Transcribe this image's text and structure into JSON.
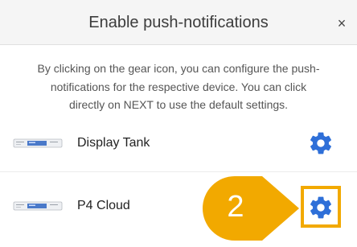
{
  "dialog": {
    "title": "Enable push-notifications",
    "close_label": "×"
  },
  "description": "By clicking on the gear icon, you can configure the push-notifications for the respective device. You can click directly on NEXT to use the default settings.",
  "devices": [
    {
      "name": "Display Tank",
      "icon": "gear-icon"
    },
    {
      "name": "P4 Cloud",
      "icon": "gear-icon"
    }
  ],
  "annotation": {
    "step_number": "2",
    "color": "#f2a900"
  },
  "colors": {
    "accent": "#2e6fd8",
    "header_bg": "#f5f5f5"
  }
}
